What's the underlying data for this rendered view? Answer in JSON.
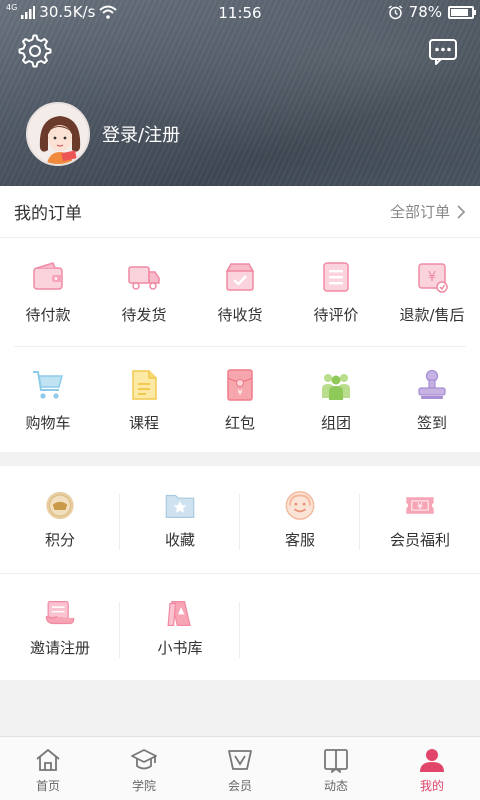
{
  "status_bar": {
    "network": "4G",
    "speed": "30.5K/s",
    "time": "11:56",
    "battery": "78%",
    "battery_level": 0.78
  },
  "profile": {
    "login_label": "登录/注册"
  },
  "orders": {
    "title": "我的订单",
    "all_label": "全部订单",
    "row1": [
      {
        "label": "待付款",
        "icon": "wallet-icon"
      },
      {
        "label": "待发货",
        "icon": "truck-icon"
      },
      {
        "label": "待收货",
        "icon": "box-check-icon"
      },
      {
        "label": "待评价",
        "icon": "review-icon"
      },
      {
        "label": "退款/售后",
        "icon": "refund-icon"
      }
    ],
    "row2": [
      {
        "label": "购物车",
        "icon": "cart-icon"
      },
      {
        "label": "课程",
        "icon": "course-icon"
      },
      {
        "label": "红包",
        "icon": "red-packet-icon"
      },
      {
        "label": "组团",
        "icon": "group-icon"
      },
      {
        "label": "签到",
        "icon": "stamp-icon"
      }
    ]
  },
  "services": {
    "row1": [
      {
        "label": "积分",
        "icon": "points-icon"
      },
      {
        "label": "收藏",
        "icon": "favorite-folder-icon"
      },
      {
        "label": "客服",
        "icon": "customer-service-icon"
      },
      {
        "label": "会员福利",
        "icon": "coupon-icon"
      }
    ],
    "row2": [
      {
        "label": "邀请注册",
        "icon": "invite-icon"
      },
      {
        "label": "小书库",
        "icon": "bookshelf-icon"
      }
    ]
  },
  "bottom_nav": [
    {
      "label": "首页",
      "icon": "home-icon",
      "active": false
    },
    {
      "label": "学院",
      "icon": "academy-icon",
      "active": false
    },
    {
      "label": "会员",
      "icon": "vip-icon",
      "active": false
    },
    {
      "label": "动态",
      "icon": "book-icon",
      "active": false
    },
    {
      "label": "我的",
      "icon": "profile-icon",
      "active": true
    }
  ],
  "colors": {
    "accent": "#e2456a",
    "icon_pink": "#f3a1b4",
    "icon_gray": "#777777"
  }
}
